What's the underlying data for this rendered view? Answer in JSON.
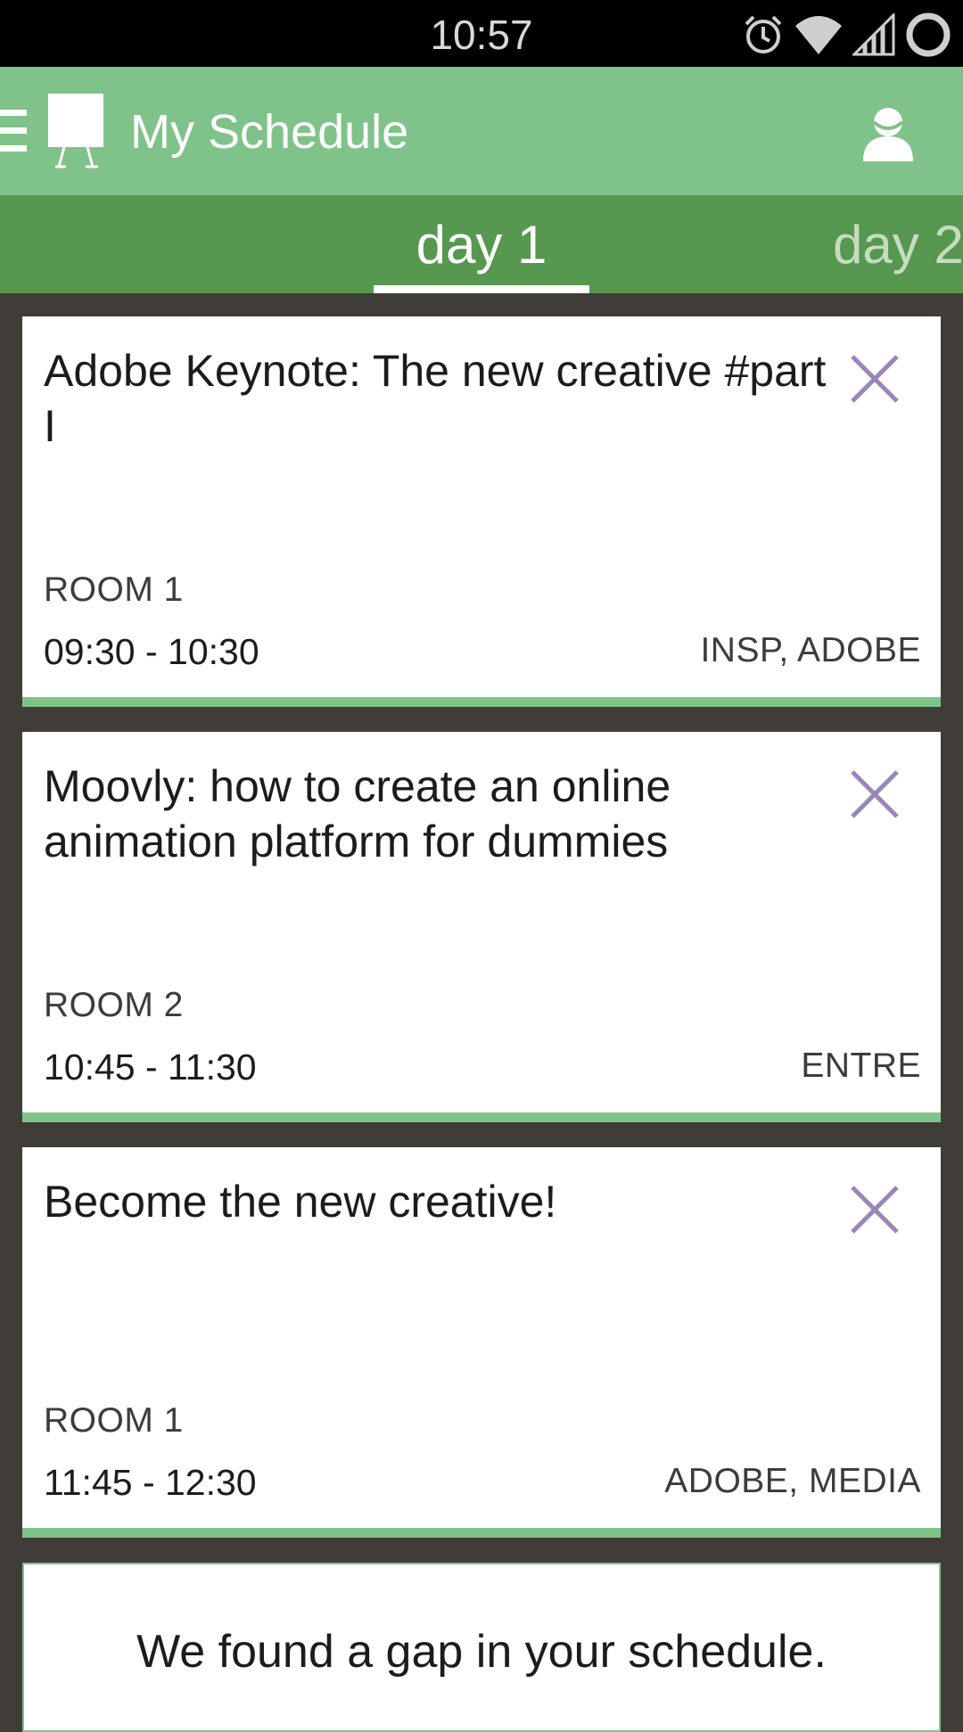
{
  "status_bar": {
    "time": "10:57",
    "icons": [
      "alarm-icon",
      "wifi-icon",
      "signal-icon",
      "circle-icon"
    ]
  },
  "app_bar": {
    "title": "My Schedule",
    "background": "#80c38a"
  },
  "tabs": [
    {
      "label": "day 1",
      "active": true
    },
    {
      "label": "day 2",
      "active": false
    }
  ],
  "sessions": [
    {
      "title": "Adobe Keynote: The new creative #part I",
      "room": "ROOM 1",
      "time": "09:30 - 10:30",
      "tags": "INSP, ADOBE"
    },
    {
      "title": "Moovly: how to create an online animation platform for dummies",
      "room": "ROOM 2",
      "time": "10:45 - 11:30",
      "tags": "ENTRE"
    },
    {
      "title": "Become the new creative!",
      "room": "ROOM 1",
      "time": "11:45 - 12:30",
      "tags": "ADOBE, MEDIA"
    }
  ],
  "gap_notice": {
    "text": "We found a gap in your schedule."
  },
  "colors": {
    "accent_green": "#80c38a",
    "tab_green": "#56984f",
    "close_purple": "#9b86b8",
    "background": "#403d39"
  }
}
